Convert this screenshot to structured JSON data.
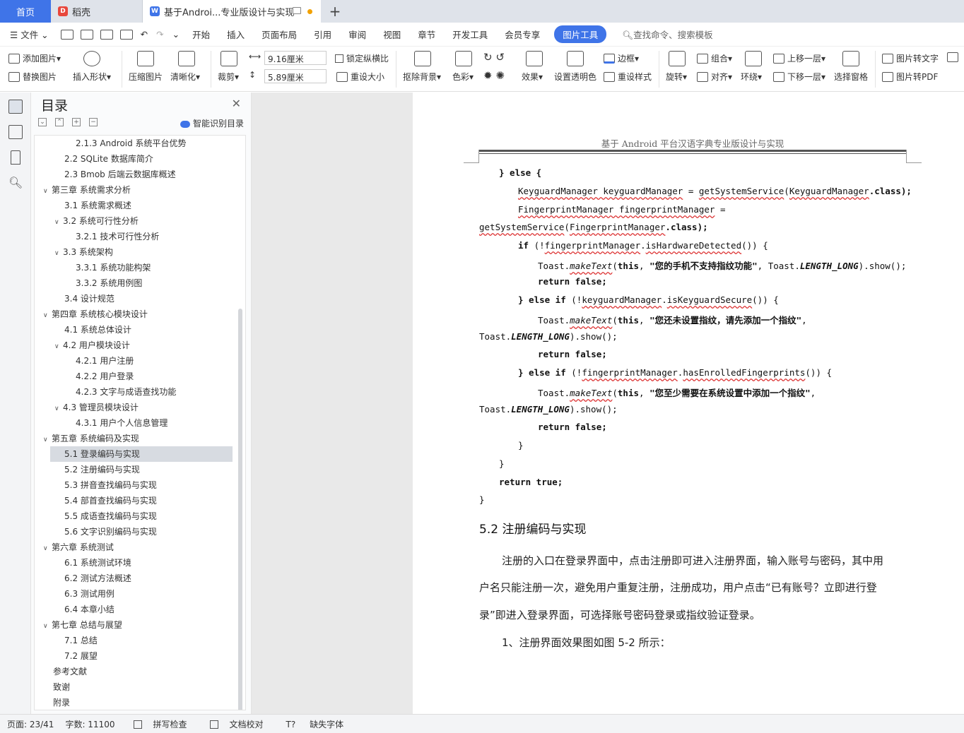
{
  "tabs": {
    "home": "首页",
    "daoke": "稻壳",
    "doc": "基于Androi...专业版设计与实现"
  },
  "menu": {
    "file": "文件",
    "items": [
      "开始",
      "插入",
      "页面布局",
      "引用",
      "审阅",
      "视图",
      "章节",
      "开发工具",
      "会员专享"
    ],
    "active": "图片工具",
    "search": "查找命令、搜索模板"
  },
  "ribbon": {
    "add_image": "添加图片",
    "replace_image": "替换图片",
    "insert_shape": "插入形状",
    "compress": "压缩图片",
    "sharpen": "清晰化",
    "crop": "裁剪",
    "width": "9.16厘米",
    "height": "5.89厘米",
    "lock_ratio": "锁定纵横比",
    "reset_size": "重设大小",
    "remove_bg": "抠除背景",
    "color": "色彩",
    "effect": "效果",
    "set_transparent": "设置透明色",
    "border": "边框",
    "reset_style": "重设样式",
    "rotate": "旋转",
    "group": "组合",
    "align": "对齐",
    "wrap": "环绕",
    "bring_forward": "上移一层",
    "send_backward": "下移一层",
    "selection_pane": "选择窗格",
    "img_to_text": "图片转文字",
    "img_to_pdf": "图片转PDF"
  },
  "toc": {
    "title": "目录",
    "smart": "智能识别目录",
    "items": [
      {
        "label": "2.1.3 Android 系统平台优势",
        "level": 3
      },
      {
        "label": "2.2 SQLite 数据库简介",
        "level": 2
      },
      {
        "label": "2.3 Bmob 后端云数据库概述",
        "level": 2
      },
      {
        "label": "第三章  系统需求分析",
        "level": 1,
        "caret": true
      },
      {
        "label": "3.1  系统需求概述",
        "level": 2
      },
      {
        "label": "3.2  系统可行性分析",
        "level": 2,
        "caret": true
      },
      {
        "label": "3.2.1  技术可行性分析",
        "level": 3
      },
      {
        "label": "3.3  系统架构",
        "level": 2,
        "caret": true
      },
      {
        "label": "3.3.1  系统功能构架",
        "level": 3
      },
      {
        "label": "3.3.2  系统用例图",
        "level": 3
      },
      {
        "label": "3.4  设计规范",
        "level": 2
      },
      {
        "label": "第四章  系统核心模块设计",
        "level": 1,
        "caret": true
      },
      {
        "label": "4.1  系统总体设计",
        "level": 2
      },
      {
        "label": "4.2  用户模块设计",
        "level": 2,
        "caret": true
      },
      {
        "label": "4.2.1  用户注册",
        "level": 3
      },
      {
        "label": "4.2.2  用户登录",
        "level": 3
      },
      {
        "label": "4.2.3  文字与成语查找功能",
        "level": 3
      },
      {
        "label": "4.3  管理员模块设计",
        "level": 2,
        "caret": true
      },
      {
        "label": "4.3.1 用户个人信息管理",
        "level": 3
      },
      {
        "label": "第五章  系统编码及实现",
        "level": 1,
        "caret": true
      },
      {
        "label": "5.1  登录编码与实现",
        "level": 2,
        "selected": true
      },
      {
        "label": "5.2  注册编码与实现",
        "level": 2
      },
      {
        "label": "5.3  拼音查找编码与实现",
        "level": 2
      },
      {
        "label": "5.4  部首查找编码与实现",
        "level": 2
      },
      {
        "label": "5.5  成语查找编码与实现",
        "level": 2
      },
      {
        "label": "5.6 文字识别编码与实现",
        "level": 2
      },
      {
        "label": "第六章  系统测试",
        "level": 1,
        "caret": true
      },
      {
        "label": "6.1  系统测试环境",
        "level": 2
      },
      {
        "label": "6.2  测试方法概述",
        "level": 2
      },
      {
        "label": "6.3  测试用例",
        "level": 2
      },
      {
        "label": "6.4  本章小结",
        "level": 2
      },
      {
        "label": "第七章  总结与展望",
        "level": 1,
        "caret": true
      },
      {
        "label": "7.1  总结",
        "level": 2
      },
      {
        "label": "7.2  展望",
        "level": 2
      },
      {
        "label": "参考文献",
        "level": 1
      },
      {
        "label": "致谢",
        "level": 1
      },
      {
        "label": "附录",
        "level": 1
      }
    ]
  },
  "doc": {
    "header": "基于 Android 平台汉语字典专业版设计与实现",
    "code": {
      "l1": "} else {",
      "l2a": "KeyguardManager keyguardManager",
      "l2b": " = ",
      "l2c": "getSystemService",
      "l2d": "(",
      "l2e": "KeyguardManager",
      "l2f": ".class);",
      "l3a": "FingerprintManager fingerprintManager",
      "l3b": " =",
      "l4a": "getSystemService",
      "l4b": "(",
      "l4c": "FingerprintManager",
      "l4d": ".class);",
      "l5a": "if",
      "l5b": " (!",
      "l5c": "fingerprintManager",
      "l5d": ".",
      "l5e": "isHardwareDetected",
      "l5f": "()) {",
      "l6a": "Toast.",
      "l6b": "makeText",
      "l6c": "(",
      "l6d": "this",
      "l6e": ", ",
      "l6f": "\"您的手机不支持指纹功能\"",
      "l6g": ", Toast.",
      "l6h": "LENGTH_LONG",
      "l6i": ").show();",
      "l7": "return false;",
      "l8a": "} else if",
      "l8b": " (!",
      "l8c": "keyguardManager",
      "l8d": ".",
      "l8e": "isKeyguardSecure",
      "l8f": "()) {",
      "l9a": "Toast.",
      "l9b": "makeText",
      "l9c": "(",
      "l9d": "this",
      "l9e": ", ",
      "l9f": "\"您还未设置指纹，请先添加一个指纹\"",
      "l9g": ",",
      "l10a": "Toast.",
      "l10b": "LENGTH_LONG",
      "l10c": ").show();",
      "l11": "return false;",
      "l12a": "} else if",
      "l12b": " (!",
      "l12c": "fingerprintManager",
      "l12d": ".",
      "l12e": "hasEnrolledFingerprints",
      "l12f": "()) {",
      "l13a": "Toast.",
      "l13b": "makeText",
      "l13c": "(",
      "l13d": "this",
      "l13e": ", ",
      "l13f": "\"您至少需要在系统设置中添加一个指纹\"",
      "l13g": ",",
      "l14a": "Toast.",
      "l14b": "LENGTH_LONG",
      "l14c": ").show();",
      "l15": "return false;",
      "l16": "}",
      "l17": "}",
      "l18": "return true;",
      "l19": "}"
    },
    "heading": "5.2  注册编码与实现",
    "p1": "注册的入口在登录界面中，点击注册即可进入注册界面，输入账号与密码，其中用",
    "p2": "户名只能注册一次，避免用户重复注册，注册成功，用户点击“已有账号？立即进行登",
    "p3": "录”即进入登录界面，可选择账号密码登录或指纹验证登录。",
    "p4": "1、注册界面效果图如图 5-2 所示："
  },
  "status": {
    "page": "页面: 23/41",
    "words": "字数: 11100",
    "spell": "拼写检查",
    "proof": "文档校对",
    "missing_font": "缺失字体"
  },
  "colors": {
    "accent": "#3f74e8",
    "selected": "#d7dbe1",
    "wavy": "#dd3333"
  }
}
